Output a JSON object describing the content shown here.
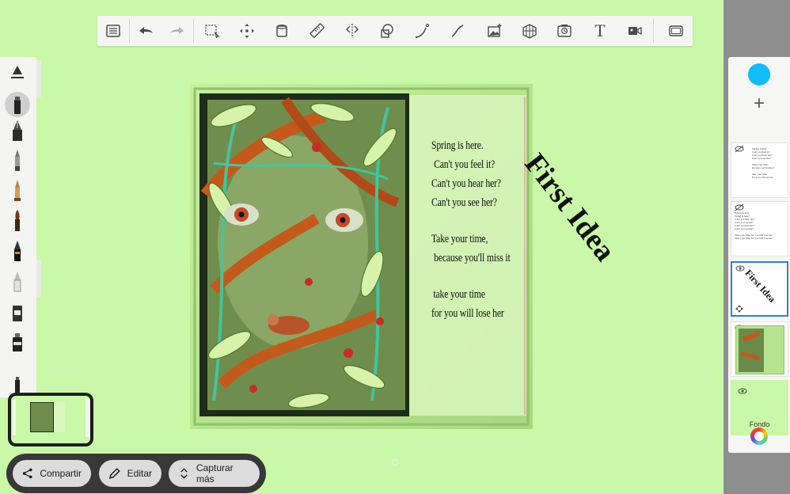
{
  "toolbar": {
    "tools": [
      {
        "name": "layers-list-icon"
      },
      {
        "name": "undo-icon"
      },
      {
        "name": "redo-icon"
      },
      {
        "name": "selection-icon"
      },
      {
        "name": "transform-icon"
      },
      {
        "name": "fill-icon"
      },
      {
        "name": "ruler-icon"
      },
      {
        "name": "symmetry-icon"
      },
      {
        "name": "shape-icon"
      },
      {
        "name": "curve-icon"
      },
      {
        "name": "stroke-icon"
      },
      {
        "name": "image-import-icon"
      },
      {
        "name": "perspective-icon"
      },
      {
        "name": "time-lapse-icon"
      },
      {
        "name": "text-icon",
        "text": "T"
      },
      {
        "name": "video-record-icon"
      },
      {
        "name": "fullscreen-icon"
      }
    ]
  },
  "poem": {
    "stanza1": [
      "Spring is here.",
      "Can't you feel it?",
      "Can't you hear her?",
      "Can't you see her?"
    ],
    "stanza2": [
      "Take your time,",
      "because you'll miss it"
    ],
    "stanza3": [
      "take your time",
      "for you will lose her"
    ]
  },
  "overlay_title": "First Idea",
  "layers": {
    "add_label": "+",
    "thumb1_text": "Spring is here\nCan't you feel it?\nCan't you hear her?\nCan't you see her?\n\nTake your time,\nbecause you'll miss it\n\ntake your time\nfor you will lose her",
    "thumb2_text": "Where is here\nString is here?\nCan't you hear her?\nCan't you see her?\nCan't you feel her?\nCan't you see her?\n\nTake your time for you will lose her\nTake your time for you will lose her",
    "thumb3_title": "First Idea",
    "background_label": "Fondo"
  },
  "colors": {
    "current_color": "#11bdfa",
    "background": "#c9f8a8"
  },
  "bottom_bar": {
    "share_label": "Compartir",
    "edit_label": "Editar",
    "capture_more_label": "Capturar más"
  }
}
